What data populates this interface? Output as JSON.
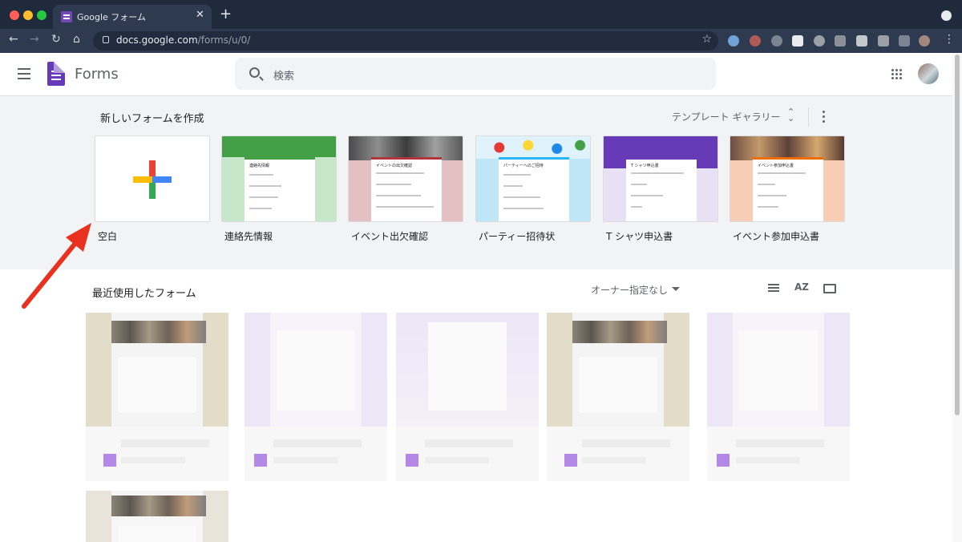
{
  "browser": {
    "tab_title": "Google フォーム",
    "url_host": "docs.google.com",
    "url_path": "/forms/u/0/",
    "close_glyph": "✕",
    "new_tab_glyph": "+",
    "back_glyph": "←",
    "forward_glyph": "→",
    "reload_glyph": "↻",
    "home_glyph": "⌂",
    "star_glyph": "☆",
    "menu_glyph": "⋮"
  },
  "app": {
    "name": "Forms",
    "search_placeholder": "検索",
    "accent_color": "#673ab7"
  },
  "gallery": {
    "title": "新しいフォームを作成",
    "template_gallery_label": "テンプレート ギャラリー",
    "templates": [
      {
        "label": "空白",
        "preview_title": ""
      },
      {
        "label": "連絡先情報",
        "preview_title": "連絡先情報"
      },
      {
        "label": "イベント出欠確認",
        "preview_title": "イベントの出欠確認"
      },
      {
        "label": "パーティー招待状",
        "preview_title": "パーティーへのご招待"
      },
      {
        "label": "T シャツ申込書",
        "preview_title": "T シャツ申込書"
      },
      {
        "label": "イベント参加申込書",
        "preview_title": "イベント参加申込書"
      }
    ]
  },
  "recent": {
    "title": "最近使用したフォーム",
    "owner_filter": "オーナー指定なし",
    "sort_label": "AZ"
  }
}
